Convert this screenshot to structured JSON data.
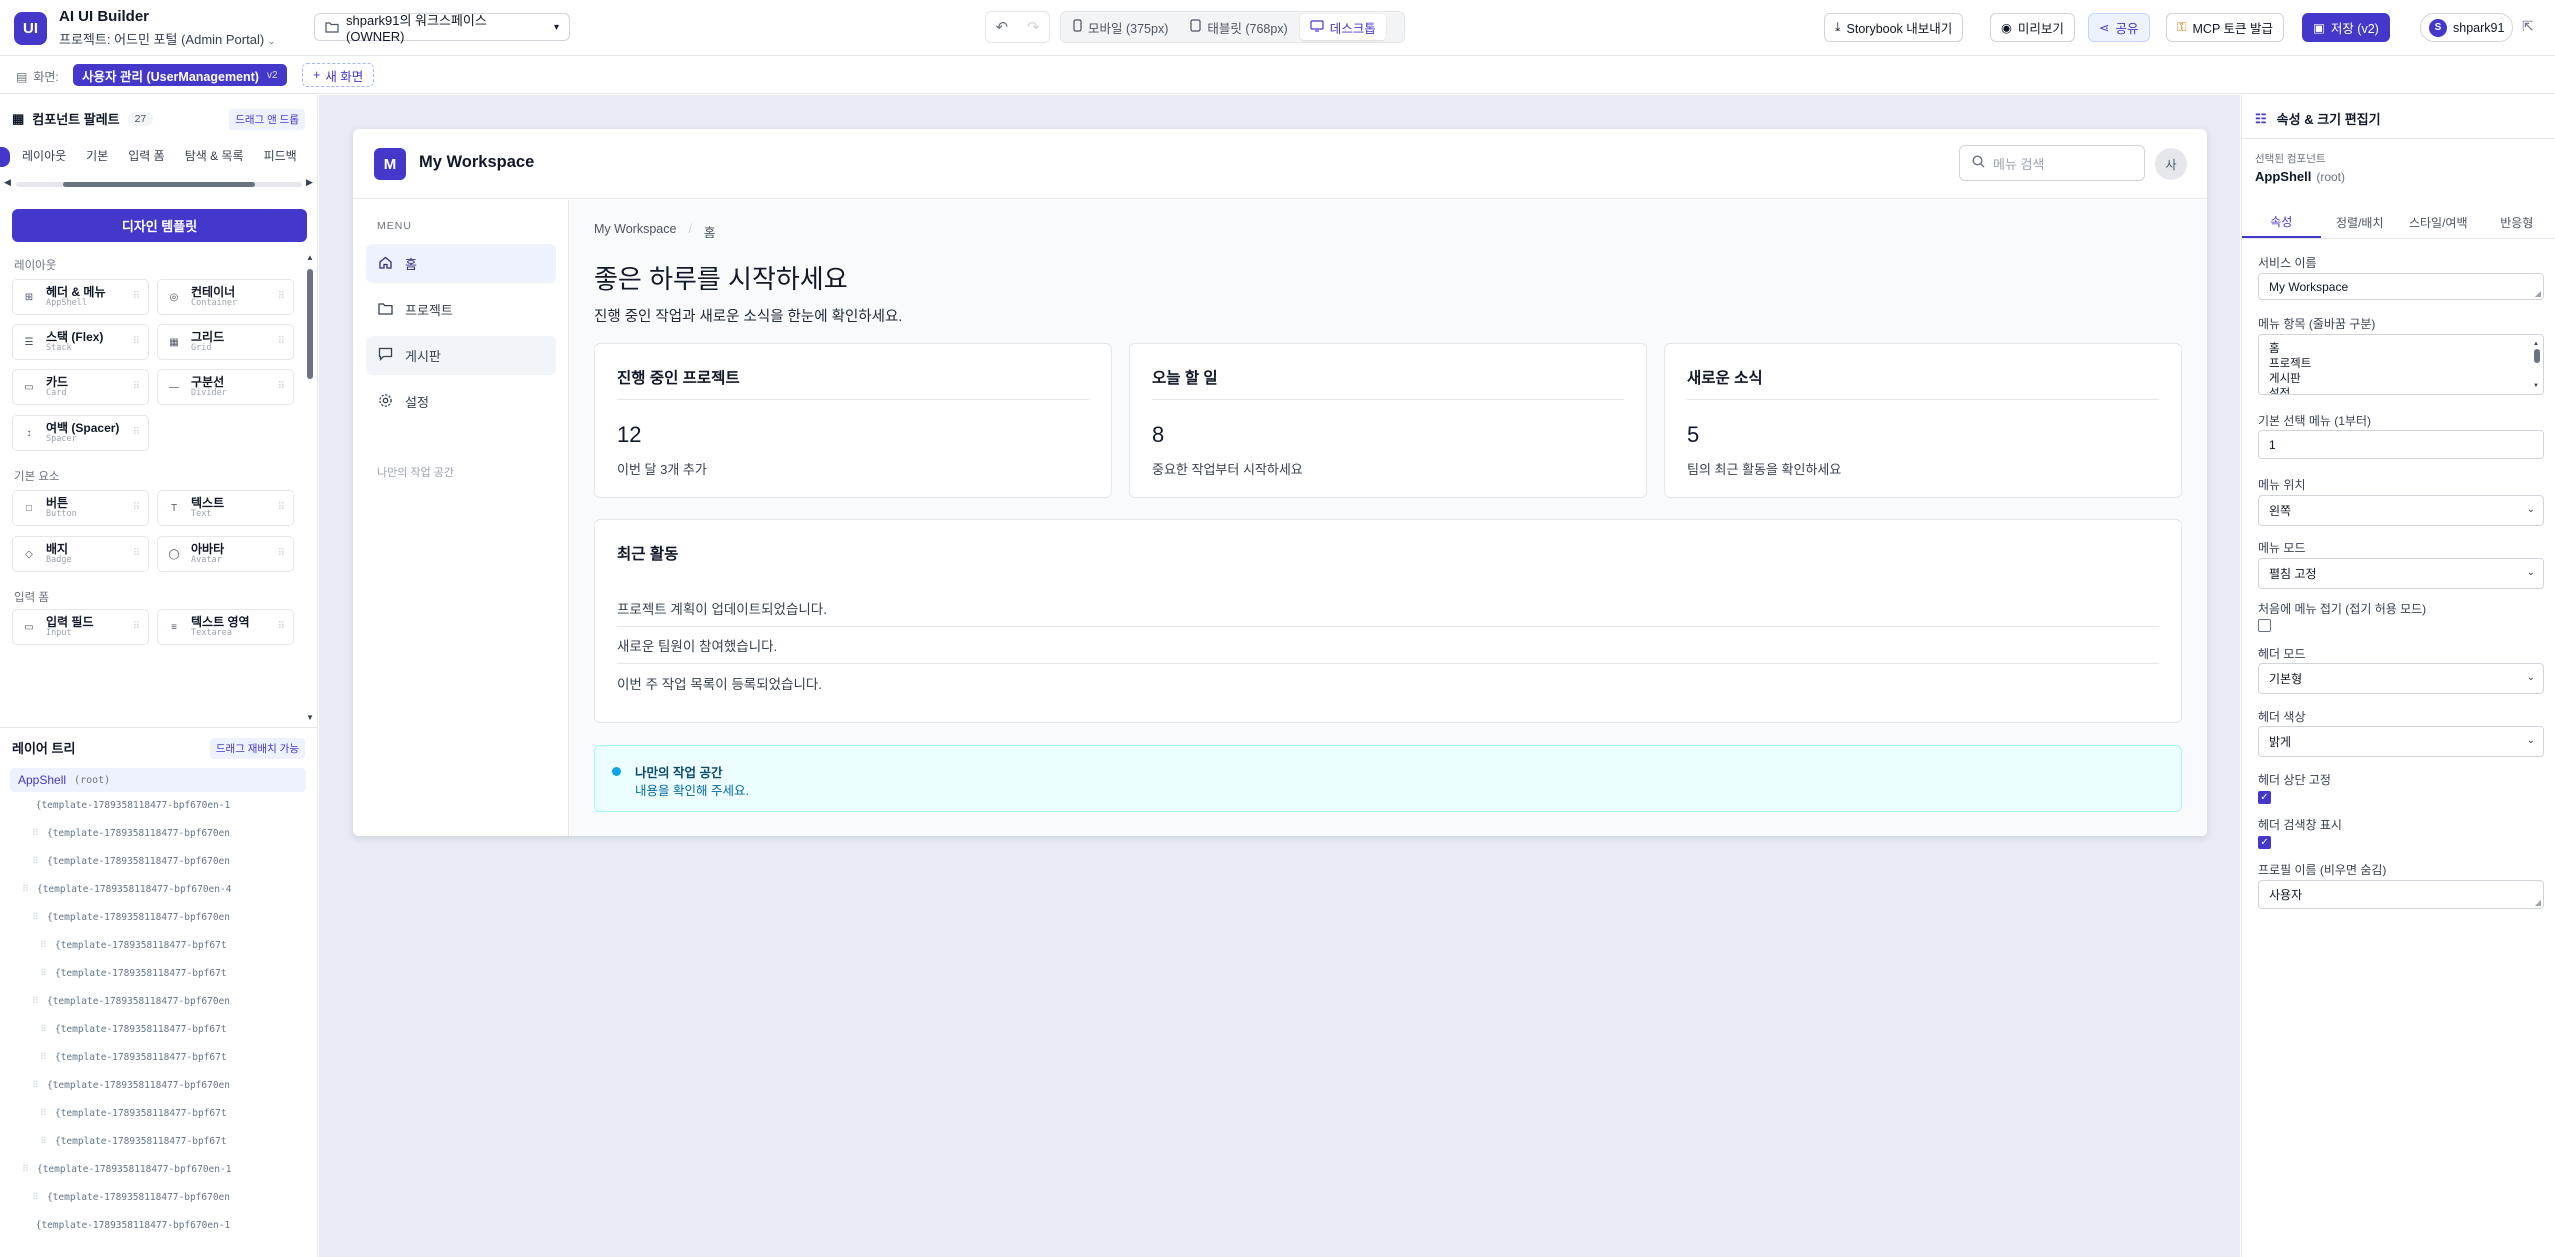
{
  "app": {
    "logo": "UI",
    "title": "AI UI Builder",
    "project": "프로젝트: 어드민 포털 (Admin Portal)"
  },
  "workspace": {
    "label": "shpark91의 워크스페이스 (OWNER)"
  },
  "devices": [
    {
      "label": "모바일 (375px)",
      "icon": "phone-icon"
    },
    {
      "label": "태블릿 (768px)",
      "icon": "tablet-icon"
    },
    {
      "label": "데스크톱",
      "icon": "monitor-icon",
      "active": true
    }
  ],
  "toolbar": {
    "storybook": "Storybook 내보내기",
    "preview": "미리보기",
    "share": "공유",
    "mcp": "MCP 토큰 발급",
    "save": "저장 (v2)",
    "user_initial": "S",
    "user_name": "shpark91"
  },
  "screen": {
    "label": "화면:",
    "current": "사용자 관리 (UserManagement)",
    "version": "v2",
    "new": "새 화면"
  },
  "palette": {
    "title": "컴포넌트 팔레트",
    "count": "27",
    "badge": "드래그 앤 드롭",
    "tabs": [
      "레이아웃",
      "기본",
      "입력 폼",
      "탐색 & 목록",
      "피드백"
    ],
    "design_template": "디자인 템플릿",
    "sections": {
      "layout": "레이아웃",
      "basic": "기본 요소",
      "form": "입력 폼"
    },
    "items": [
      {
        "name": "헤더 & 메뉴",
        "code": "AppShell",
        "icon": "⊞"
      },
      {
        "name": "컨테이너",
        "code": "Container",
        "icon": "◎"
      },
      {
        "name": "스택 (Flex)",
        "code": "Stack",
        "icon": "☰"
      },
      {
        "name": "그리드",
        "code": "Grid",
        "icon": "▦"
      },
      {
        "name": "카드",
        "code": "Card",
        "icon": "▭"
      },
      {
        "name": "구분선",
        "code": "Divider",
        "icon": "—"
      },
      {
        "name": "여백 (Spacer)",
        "code": "Spacer",
        "icon": "↕"
      },
      {
        "name": "버튼",
        "code": "Button",
        "icon": "□"
      },
      {
        "name": "텍스트",
        "code": "Text",
        "icon": "T"
      },
      {
        "name": "배지",
        "code": "Badge",
        "icon": "◇"
      },
      {
        "name": "아바타",
        "code": "Avatar",
        "icon": "◯"
      },
      {
        "name": "입력 필드",
        "code": "Input",
        "icon": "▭"
      },
      {
        "name": "텍스트 영역",
        "code": "Textarea",
        "icon": "≡"
      }
    ]
  },
  "layers": {
    "title": "레이어 트리",
    "badge": "드래그 재배치 가능",
    "root": "AppShell",
    "root_sub": "(root)",
    "items": [
      "{template-1789358118477-bpf670en-1",
      "{template-1789358118477-bpf670en",
      "{template-1789358118477-bpf670en",
      "{template-1789358118477-bpf670en-4",
      "{template-1789358118477-bpf670en",
      "{template-1789358118477-bpf67t",
      "{template-1789358118477-bpf67t",
      "{template-1789358118477-bpf670en",
      "{template-1789358118477-bpf67t",
      "{template-1789358118477-bpf67t",
      "{template-1789358118477-bpf670en",
      "{template-1789358118477-bpf67t",
      "{template-1789358118477-bpf67t",
      "{template-1789358118477-bpf670en-1",
      "{template-1789358118477-bpf670en",
      "{template-1789358118477-bpf670en-1"
    ]
  },
  "preview": {
    "logo": "M",
    "title": "My Workspace",
    "search_placeholder": "메뉴 검색",
    "avatar": "사",
    "menu_label": "MENU",
    "nav": [
      "홈",
      "프로젝트",
      "게시판",
      "설정"
    ],
    "side_footer": "나만의 작업 공간",
    "breadcrumb": [
      "My Workspace",
      "/",
      "홈"
    ],
    "page_title": "좋은 하루를 시작하세요",
    "page_desc": "진행 중인 작업과 새로운 소식을 한눈에 확인하세요.",
    "cards": [
      {
        "title": "진행 중인 프로젝트",
        "value": "12",
        "sub": "이번 달 3개 추가"
      },
      {
        "title": "오늘 할 일",
        "value": "8",
        "sub": "중요한 작업부터 시작하세요"
      },
      {
        "title": "새로운 소식",
        "value": "5",
        "sub": "팀의 최근 활동을 확인하세요"
      }
    ],
    "recent_title": "최근 활동",
    "recent": [
      "프로젝트 계획이 업데이트되었습니다.",
      "새로운 팀원이 참여했습니다.",
      "이번 주 작업 목록이 등록되었습니다."
    ],
    "notice_title": "나만의 작업 공간",
    "notice_desc": "내용을 확인해 주세요."
  },
  "inspector": {
    "title": "속성 & 크기 편집기",
    "selected_label": "선택된 컴포넌트",
    "selected": "AppShell",
    "selected_sub": "(root)",
    "tabs": [
      "속성",
      "정렬/배치",
      "스타일/여백",
      "반응형"
    ],
    "fields": {
      "service_name_label": "서비스 이름",
      "service_name": "My Workspace",
      "menu_items_label": "메뉴 항목 (줄바꿈 구분)",
      "menu_items": [
        "홈",
        "프로젝트",
        "게시판",
        "설정"
      ],
      "default_menu_label": "기본 선택 메뉴 (1부터)",
      "default_menu": "1",
      "menu_position_label": "메뉴 위치",
      "menu_position": "왼쪽",
      "menu_mode_label": "메뉴 모드",
      "menu_mode": "펼침 고정",
      "collapse_label": "처음에 메뉴 접기 (접기 허용 모드)",
      "collapse": false,
      "header_mode_label": "헤더 모드",
      "header_mode": "기본형",
      "header_color_label": "헤더 색상",
      "header_color": "밝게",
      "header_sticky_label": "헤더 상단 고정",
      "header_sticky": true,
      "header_search_label": "헤더 검색창 표시",
      "header_search": true,
      "profile_name_label": "프로필 이름 (비우면 숨김)",
      "profile_name": "사용자"
    }
  },
  "colors": {
    "accent": "#4338ca",
    "canvas": "#e8ebf3",
    "notice_bg": "#ecfeff"
  }
}
